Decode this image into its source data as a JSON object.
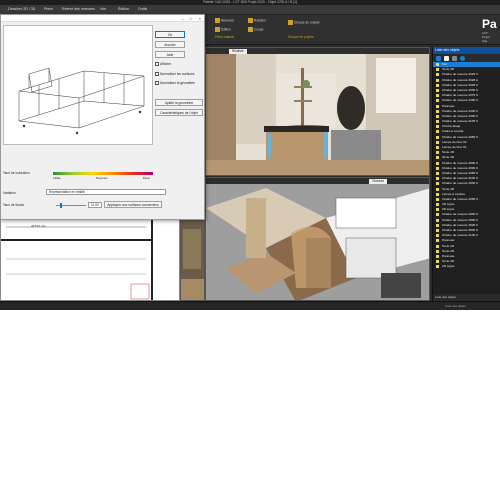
{
  "window": {
    "title": "Palette CAD 2025 - LOT B03 Projet 2025 - Objet CRD A / B [1]"
  },
  "menu": {
    "items": [
      "Dessiner 2D / 3D",
      "Pièce",
      "Relevé des mesures",
      "Vue",
      "Édition",
      "Outils"
    ]
  },
  "ribbon": {
    "groups": [
      {
        "label": "Pièce-maison",
        "buttons": [
          "Moulures",
          "Édition"
        ]
      },
      {
        "label": "Pièce-fine",
        "buttons": [
          "Rotation",
          "Coupe"
        ]
      },
      {
        "label": "Groupe de projets",
        "buttons": [
          "Groupe de projets",
          "Changer ..."
        ]
      }
    ]
  },
  "brand": {
    "name": "Pa",
    "lines": [
      "LOT",
      "Projet",
      "Vue"
    ]
  },
  "viewports": {
    "render": {
      "label": "",
      "dropdown": "Réaliste"
    },
    "iso": {
      "label": "",
      "dropdown": "Textures"
    },
    "plan": {
      "label": "B-03",
      "label2": "B-03",
      "dim": "4374,0 mm"
    }
  },
  "statusbar": {
    "left": "",
    "right": "Liste des objets"
  },
  "objects": {
    "header": "Liste des objets",
    "footer": "Liste des objets",
    "items": [
      "Toit",
      "Texte 2D",
      "Chaîne de mesure 4326 C",
      "Chaîne de mesure 3328 A",
      "Chaîne de mesure 3305 C",
      "Chaîne de mesure 3330 C",
      "Chaîne de mesure 3375 C",
      "Chaîne de mesure 4390 C",
      "Panneau",
      "Chaîne de mesure 3400 C",
      "Chaîne de mesure 3400 C",
      "Chaîne de mesure 4105 C",
      "Cloche-abajo",
      "Cadre à contrat",
      "Chaîne de mesure 4050 C",
      "Lampe de bloc 02",
      "Lampe de bloc 01",
      "Texte 2D",
      "Texte 2D",
      "Chaîne de mesure 4000 C",
      "Chaîne de mesure 4000 C",
      "Chaîne de mesure 4050 C",
      "Chaîne de mesure 3100 C",
      "Chaîne de mesure 4000 C",
      "Texte 2D",
      "Lampe à coulure",
      "Chaîne de mesure 4050 C",
      "2D Ligne",
      "2D Ligne",
      "Chaîne de mesure 4000 C",
      "Chaîne de mesure 3900 C",
      "Chaîne de mesure 4500 C",
      "Chaîne de mesure 3900 C",
      "Chaîne de mesure 4100 C",
      "Panneau",
      "Texte 2D",
      "Texte 2D",
      "Panneau",
      "Texte 2D",
      "2D Ligne"
    ]
  },
  "dialog": {
    "buttons": {
      "ok": "Ok",
      "cancel": "Annuler",
      "help": "Aide",
      "simplify": "Aplatir la géométrie",
      "characteristics": "Caractéristiques de l'objet",
      "apply": "Appliquer aux surfaces concernées"
    },
    "checks": [
      "Afficher",
      "Normaliser les surfaces",
      "Normaliser la géométrie"
    ],
    "scale_label": "Taux de coloration",
    "scale_ticks": [
      "Faible",
      "Moyenne",
      "Élevé"
    ],
    "fields": [
      {
        "label": "Variation",
        "value": "Représentation en réalité"
      },
      {
        "label": "Taux de fusion",
        "value": "11,00"
      }
    ]
  },
  "colors": {
    "accent": "#1a7fd4",
    "header": "#0e4f9c",
    "plan_room": "#00aacc",
    "plan_label": "#dd2222"
  }
}
